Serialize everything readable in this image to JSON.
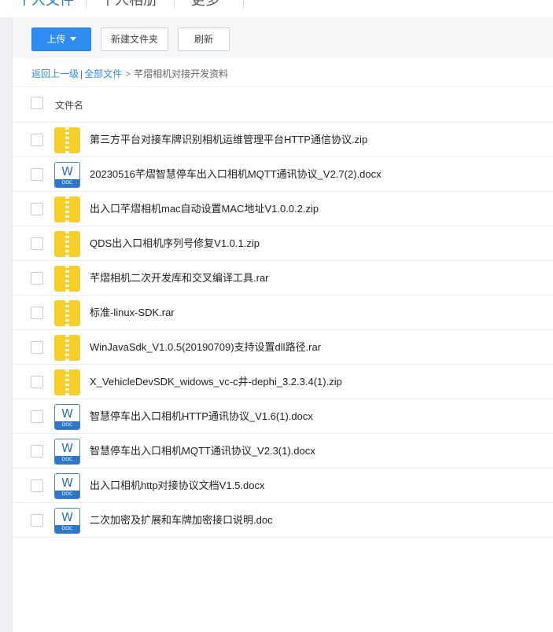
{
  "nav": {
    "tabs": [
      "个人文件",
      "个人相册",
      "更多"
    ]
  },
  "toolbar": {
    "upload_label": "上传",
    "new_folder_label": "新建文件夹",
    "refresh_label": "刷新"
  },
  "breadcrumb": {
    "back": "返回上一级",
    "divider": "|",
    "all_files": "全部文件",
    "arrow": ">",
    "current": "芊熠相机对接开发资料"
  },
  "list": {
    "header": "文件名",
    "files": [
      {
        "name": "第三方平台对接车牌识别相机运维管理平台HTTP通信协议.zip",
        "type": "zip"
      },
      {
        "name": "20230516芊熠智慧停车出入口相机MQTT通讯协议_V2.7(2).docx",
        "type": "doc"
      },
      {
        "name": "出入口芊熠相机mac自动设置MAC地址V1.0.0.2.zip",
        "type": "zip"
      },
      {
        "name": "QDS出入口相机序列号修复V1.0.1.zip",
        "type": "zip"
      },
      {
        "name": "芊熠相机二次开发库和交叉编译工具.rar",
        "type": "zip"
      },
      {
        "name": "标准-linux-SDK.rar",
        "type": "zip"
      },
      {
        "name": "WinJavaSdk_V1.0.5(20190709)支持设置dll路径.rar",
        "type": "zip"
      },
      {
        "name": "X_VehicleDevSDK_widows_vc-c井-dephi_3.2.3.4(1).zip",
        "type": "zip"
      },
      {
        "name": "智慧停车出入口相机HTTP通讯协议_V1.6(1).docx",
        "type": "doc"
      },
      {
        "name": "智慧停车出入口相机MQTT通讯协议_V2.3(1).docx",
        "type": "doc"
      },
      {
        "name": "出入口相机http对接协议文档V1.5.docx",
        "type": "doc"
      },
      {
        "name": "二次加密及扩展和车牌加密接口说明.doc",
        "type": "doc"
      }
    ]
  },
  "icons": {
    "doc_letter": "W",
    "doc_band": "DOC"
  },
  "colors": {
    "accent": "#2f8cf0",
    "zip_icon": "#f6cf2c",
    "doc_icon": "#2f76c7"
  }
}
